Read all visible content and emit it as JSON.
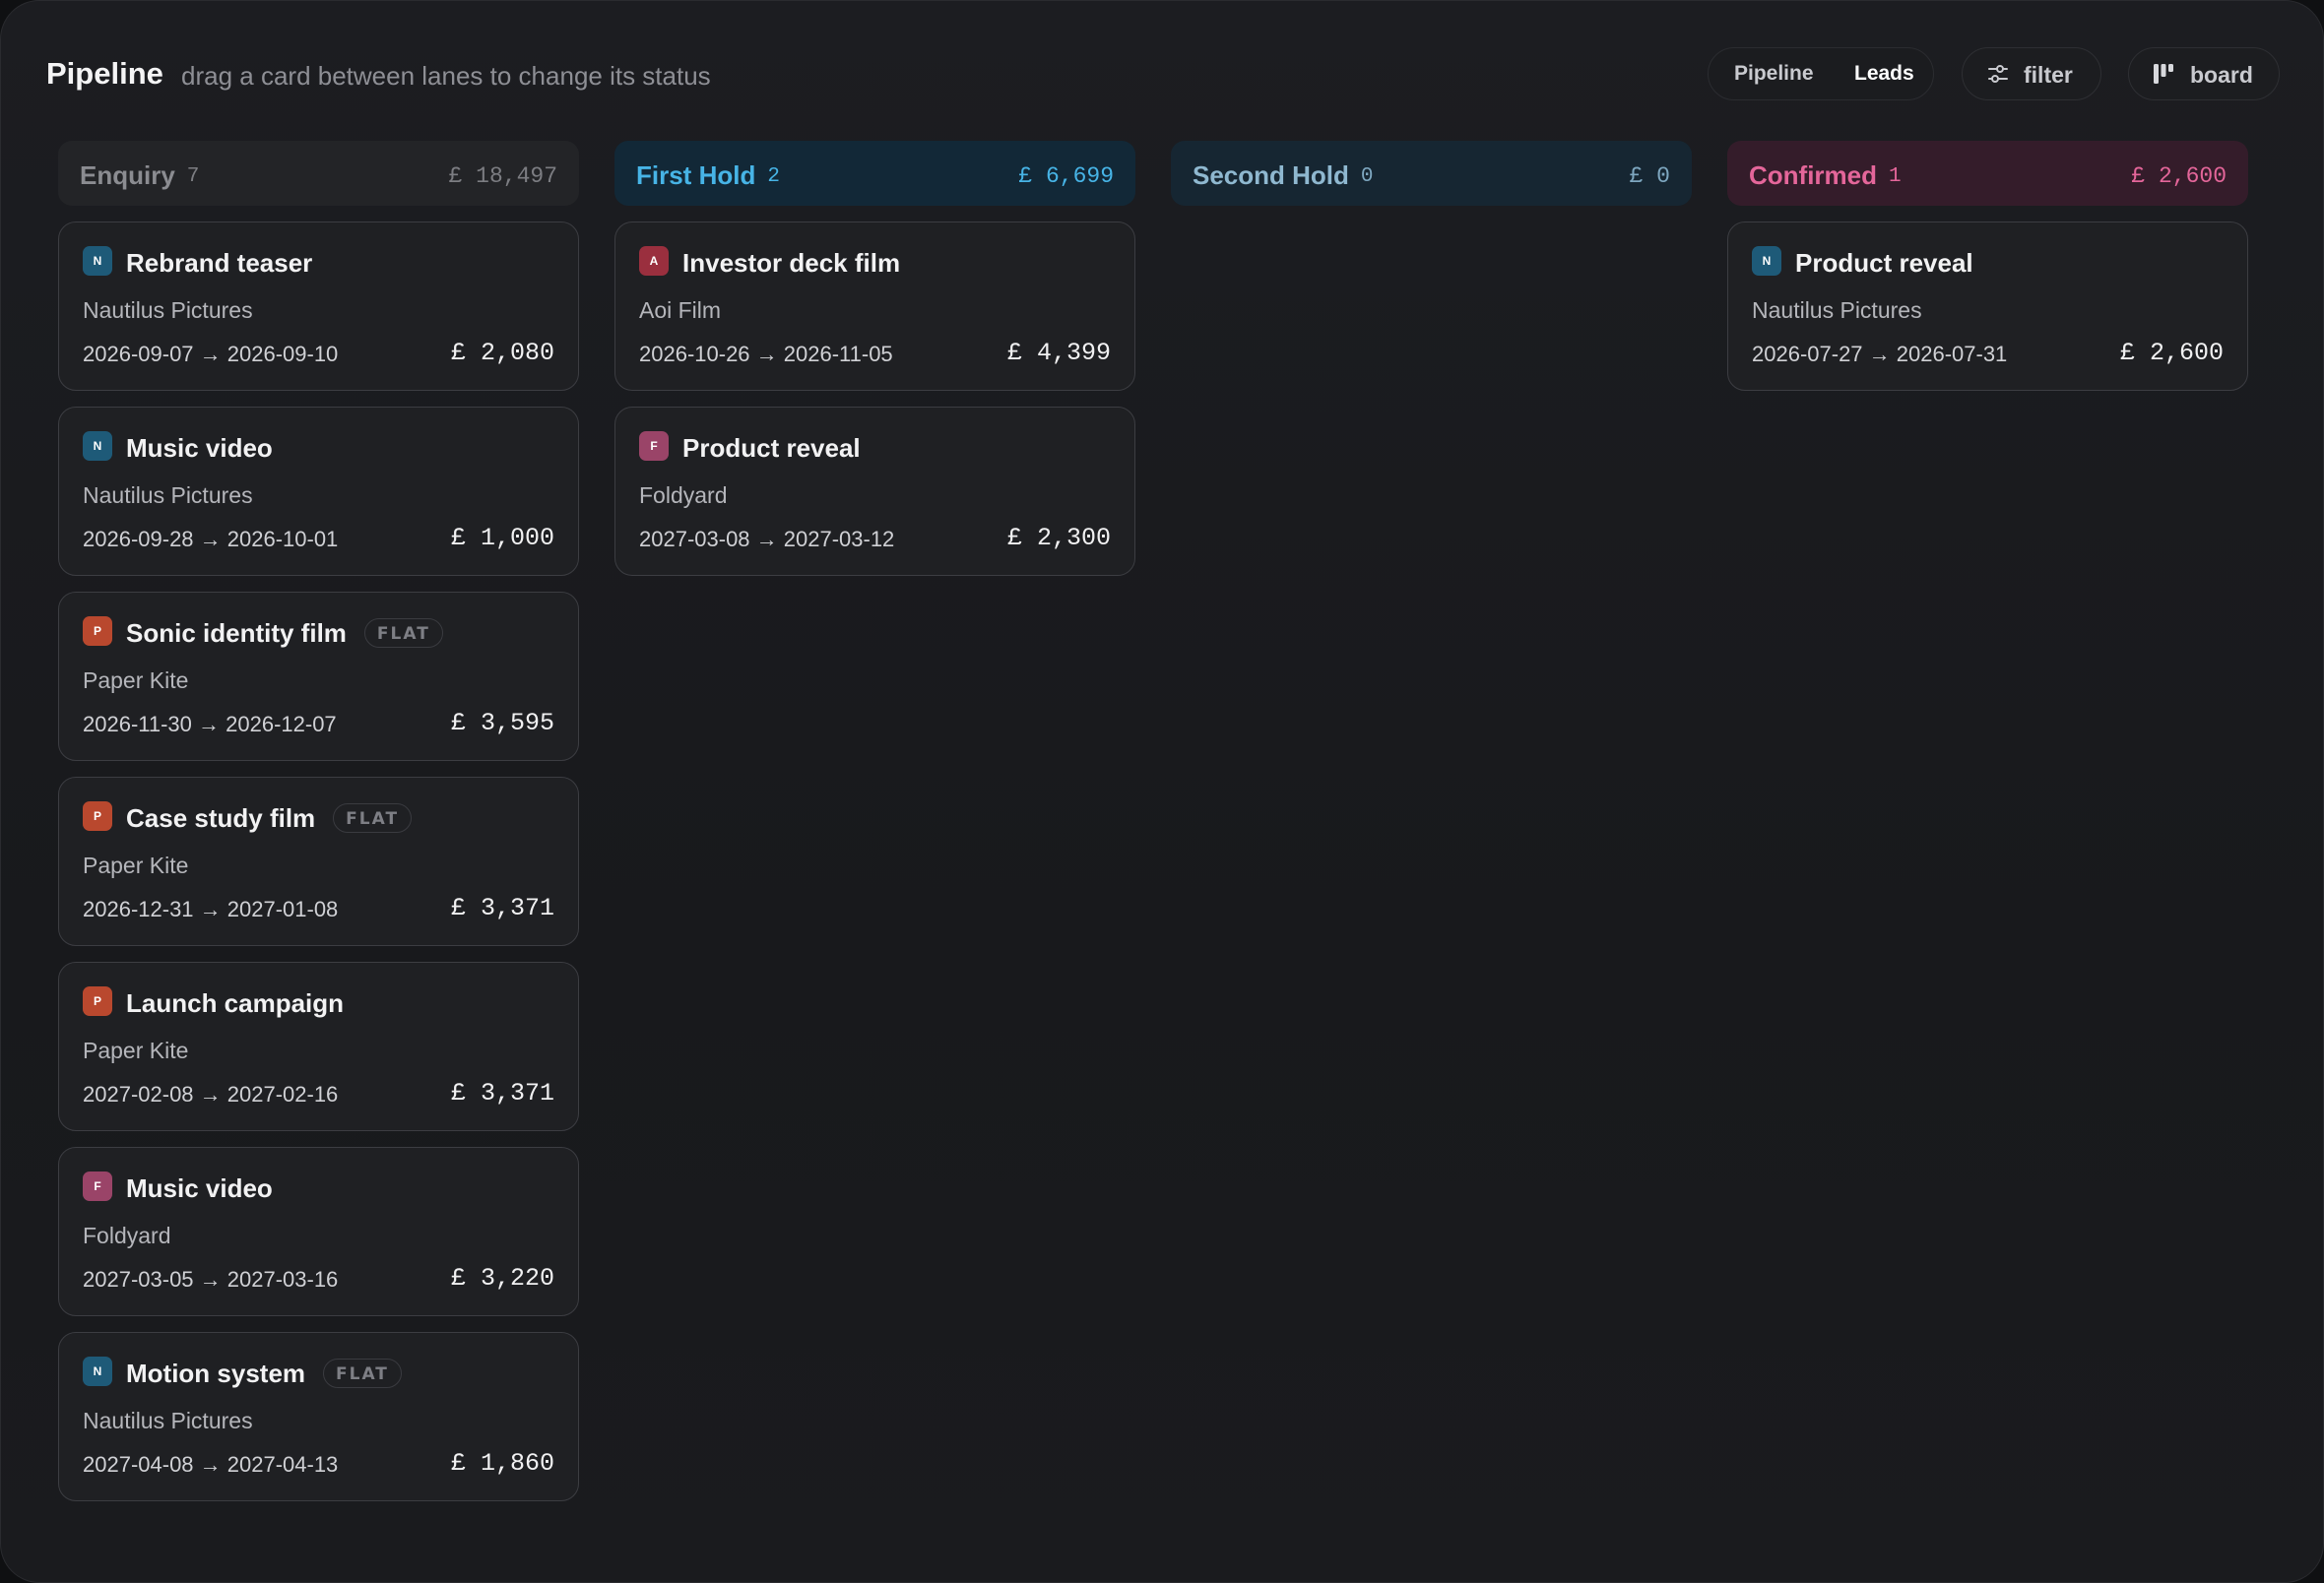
{
  "header": {
    "title": "Pipeline",
    "subtitle": "drag a card between lanes to change its status",
    "view_toggle": [
      "Pipeline",
      "Leads"
    ],
    "filter_label": "filter",
    "board_label": "board",
    "filter_icon": "sliders-icon",
    "board_icon": "kanban-icon"
  },
  "colors": {
    "enquiry": "#8b8c91",
    "first_hold": "#47b4e6",
    "second_hold": "#8fb8d0",
    "confirmed": "#e4669a",
    "avatar_N": "#1e5a78",
    "avatar_A": "#9a2f3e",
    "avatar_F": "#9a4468",
    "avatar_P": "#b9482e"
  },
  "lanes": [
    {
      "name": "Enquiry",
      "count": "7",
      "total": "£ 18,497",
      "cards": [
        {
          "initial": "N",
          "title": "Rebrand teaser",
          "flat": "",
          "client": "Nautilus Pictures",
          "dates": "2026-09-07 → 2026-09-10",
          "amount": "£ 2,080"
        },
        {
          "initial": "N",
          "title": "Music video",
          "flat": "",
          "client": "Nautilus Pictures",
          "dates": "2026-09-28 → 2026-10-01",
          "amount": "£ 1,000"
        },
        {
          "initial": "P",
          "title": "Sonic identity film",
          "flat": "FLAT",
          "client": "Paper Kite",
          "dates": "2026-11-30 → 2026-12-07",
          "amount": "£ 3,595"
        },
        {
          "initial": "P",
          "title": "Case study film",
          "flat": "FLAT",
          "client": "Paper Kite",
          "dates": "2026-12-31 → 2027-01-08",
          "amount": "£ 3,371"
        },
        {
          "initial": "P",
          "title": "Launch campaign",
          "flat": "",
          "client": "Paper Kite",
          "dates": "2027-02-08 → 2027-02-16",
          "amount": "£ 3,371"
        },
        {
          "initial": "F",
          "title": "Music video",
          "flat": "",
          "client": "Foldyard",
          "dates": "2027-03-05 → 2027-03-16",
          "amount": "£ 3,220"
        },
        {
          "initial": "N",
          "title": "Motion system",
          "flat": "FLAT",
          "client": "Nautilus Pictures",
          "dates": "2027-04-08 → 2027-04-13",
          "amount": "£ 1,860"
        }
      ]
    },
    {
      "name": "First Hold",
      "count": "2",
      "total": "£ 6,699",
      "cards": [
        {
          "initial": "A",
          "title": "Investor deck film",
          "flat": "",
          "client": "Aoi Film",
          "dates": "2026-10-26 → 2026-11-05",
          "amount": "£ 4,399"
        },
        {
          "initial": "F",
          "title": "Product reveal",
          "flat": "",
          "client": "Foldyard",
          "dates": "2027-03-08 → 2027-03-12",
          "amount": "£ 2,300"
        }
      ]
    },
    {
      "name": "Second Hold",
      "count": "0",
      "total": "£ 0",
      "cards": []
    },
    {
      "name": "Confirmed",
      "count": "1",
      "total": "£ 2,600",
      "cards": [
        {
          "initial": "N",
          "title": "Product reveal",
          "flat": "",
          "client": "Nautilus Pictures",
          "dates": "2026-07-27 → 2026-07-31",
          "amount": "£ 2,600"
        }
      ]
    }
  ]
}
